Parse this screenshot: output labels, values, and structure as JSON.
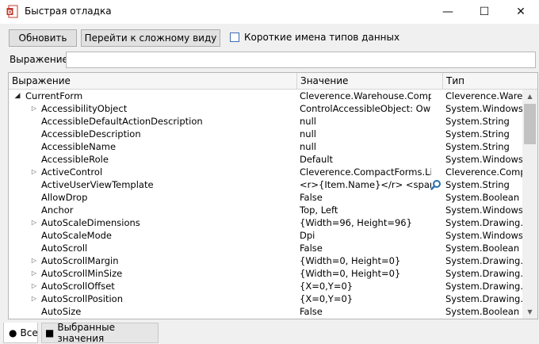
{
  "window": {
    "title": "Быстрая отладка",
    "minimize_glyph": "—",
    "maximize_glyph": "☐",
    "close_glyph": "✕"
  },
  "toolbar": {
    "refresh_label": "Обновить",
    "complex_view_label": "Перейти к сложному виду",
    "short_type_names_label": "Короткие имена типов данных",
    "short_type_names_checked": false
  },
  "expression": {
    "label": "Выражение:",
    "value": ""
  },
  "grid": {
    "columns": [
      "Выражение",
      "Значение",
      "Тип"
    ],
    "rows": [
      {
        "indent": 0,
        "expander": "expanded",
        "name": "CurrentForm",
        "value": "Cleverence.Warehouse.Compact...",
        "type": "Cleverence.Wareho"
      },
      {
        "indent": 1,
        "expander": "collapsed",
        "name": "AccessibilityObject",
        "value": "ControlAccessibleObject: Owner...",
        "type": "System.Windows.Fo"
      },
      {
        "indent": 1,
        "expander": "none",
        "name": "AccessibleDefaultActionDescription",
        "value": "null",
        "type": "System.String"
      },
      {
        "indent": 1,
        "expander": "none",
        "name": "AccessibleDescription",
        "value": "null",
        "type": "System.String"
      },
      {
        "indent": 1,
        "expander": "none",
        "name": "AccessibleName",
        "value": "null",
        "type": "System.String"
      },
      {
        "indent": 1,
        "expander": "none",
        "name": "AccessibleRole",
        "value": "Default",
        "type": "System.Windows.Fo"
      },
      {
        "indent": 1,
        "expander": "collapsed",
        "name": "ActiveControl",
        "value": "Cleverence.CompactForms.ListBox",
        "type": "Cleverence.Compac"
      },
      {
        "indent": 1,
        "expander": "none",
        "name": "ActiveUserViewTemplate",
        "value": "<r>{Item.Name}</r> <span s...",
        "type": "System.String",
        "magnifier": true
      },
      {
        "indent": 1,
        "expander": "none",
        "name": "AllowDrop",
        "value": "False",
        "type": "System.Boolean"
      },
      {
        "indent": 1,
        "expander": "none",
        "name": "Anchor",
        "value": "Top, Left",
        "type": "System.Windows.Fo"
      },
      {
        "indent": 1,
        "expander": "collapsed",
        "name": "AutoScaleDimensions",
        "value": "{Width=96, Height=96}",
        "type": "System.Drawing.Siz"
      },
      {
        "indent": 1,
        "expander": "none",
        "name": "AutoScaleMode",
        "value": "Dpi",
        "type": "System.Windows.Fo"
      },
      {
        "indent": 1,
        "expander": "none",
        "name": "AutoScroll",
        "value": "False",
        "type": "System.Boolean"
      },
      {
        "indent": 1,
        "expander": "collapsed",
        "name": "AutoScrollMargin",
        "value": "{Width=0, Height=0}",
        "type": "System.Drawing.Siz"
      },
      {
        "indent": 1,
        "expander": "collapsed",
        "name": "AutoScrollMinSize",
        "value": "{Width=0, Height=0}",
        "type": "System.Drawing.Siz"
      },
      {
        "indent": 1,
        "expander": "collapsed",
        "name": "AutoScrollOffset",
        "value": "{X=0,Y=0}",
        "type": "System.Drawing.Po"
      },
      {
        "indent": 1,
        "expander": "collapsed",
        "name": "AutoScrollPosition",
        "value": "{X=0,Y=0}",
        "type": "System.Drawing.Po"
      },
      {
        "indent": 1,
        "expander": "none",
        "name": "AutoSize",
        "value": "False",
        "type": "System.Boolean"
      }
    ]
  },
  "tabs": [
    {
      "label": "Все",
      "glyph": "●",
      "active": true
    },
    {
      "label": "Выбранные значения",
      "glyph": "■",
      "active": false
    }
  ],
  "colors": {
    "window_bg": "#f0f0f0",
    "button_bg": "#e1e1e1",
    "checkbox_border": "#3c6fb6",
    "grid_border": "#b7b7b7"
  }
}
